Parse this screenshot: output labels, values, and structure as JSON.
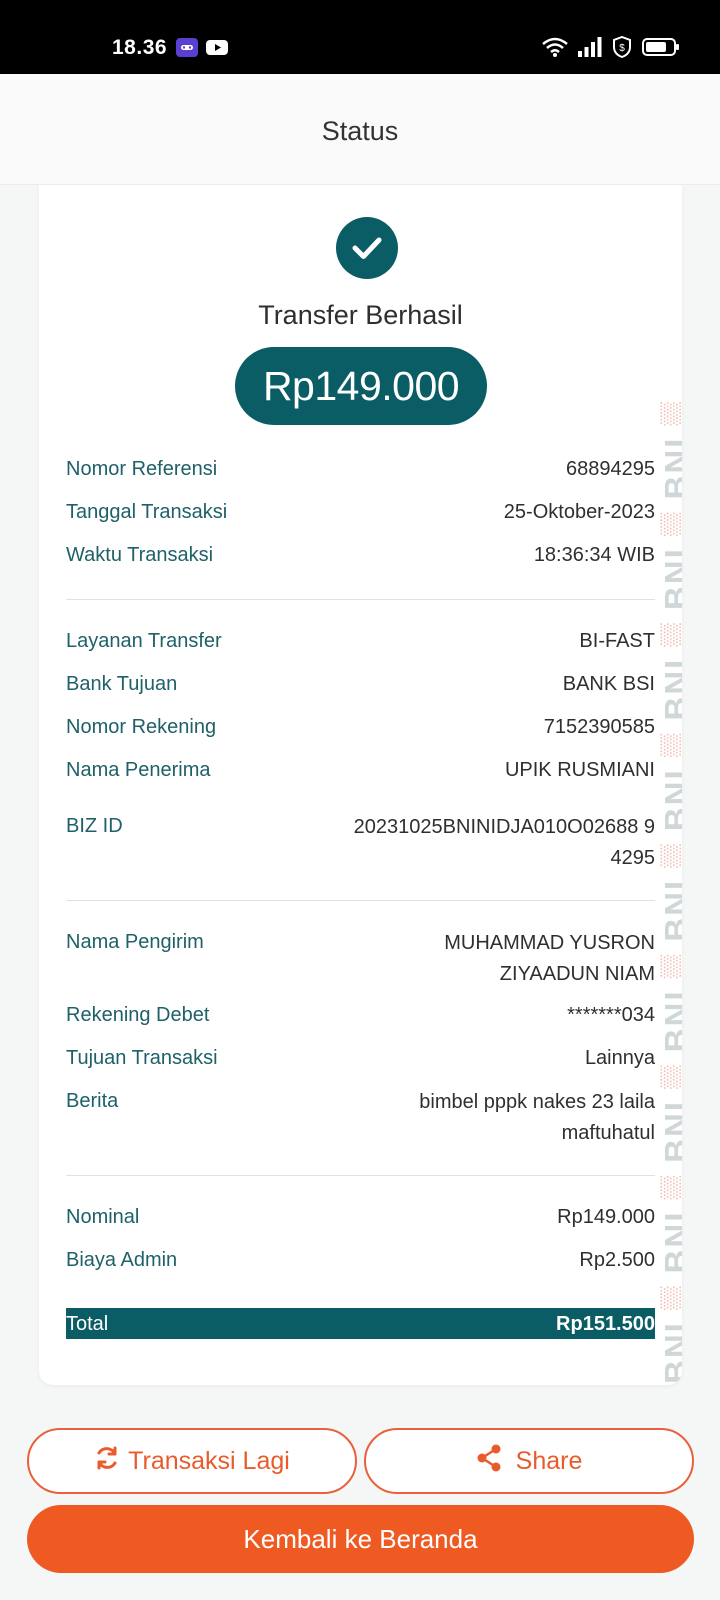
{
  "status_bar": {
    "time": "18.36"
  },
  "header": {
    "title": "Status"
  },
  "receipt": {
    "status_title": "Transfer Berhasil",
    "amount": "Rp149.000",
    "watermark": "BNI",
    "section1": [
      {
        "label": "Nomor Referensi",
        "value": "68894295"
      },
      {
        "label": "Tanggal Transaksi",
        "value": "25-Oktober-2023"
      },
      {
        "label": "Waktu Transaksi",
        "value": "18:36:34 WIB"
      }
    ],
    "section2": [
      {
        "label": "Layanan Transfer",
        "value": "BI-FAST"
      },
      {
        "label": "Bank Tujuan",
        "value": "BANK BSI"
      },
      {
        "label": "Nomor Rekening",
        "value": "7152390585"
      },
      {
        "label": "Nama Penerima",
        "value": "UPIK RUSMIANI"
      },
      {
        "label": "BIZ ID",
        "value": "20231025BNINIDJA010O02688 94295"
      }
    ],
    "section3": [
      {
        "label": "Nama Pengirim",
        "value": "MUHAMMAD YUSRON ZIYAADUN NIAM"
      },
      {
        "label": "Rekening Debet",
        "value": "*******034"
      },
      {
        "label": "Tujuan Transaksi",
        "value": "Lainnya"
      },
      {
        "label": "Berita",
        "value": "bimbel pppk nakes 23 laila maftuhatul"
      }
    ],
    "section4": [
      {
        "label": "Nominal",
        "value": "Rp149.000"
      },
      {
        "label": "Biaya Admin",
        "value": "Rp2.500"
      }
    ],
    "total": {
      "label": "Total",
      "value": "Rp151.500"
    }
  },
  "actions": {
    "repeat_label": "Transaksi Lagi",
    "share_label": "Share",
    "home_label": "Kembali ke Beranda"
  },
  "colors": {
    "primary": "#0a5c65",
    "accent": "#ef5a23"
  },
  "icons": [
    "check-icon",
    "refresh-icon",
    "share-icon",
    "wifi-icon",
    "signal-icon",
    "battery-icon"
  ]
}
